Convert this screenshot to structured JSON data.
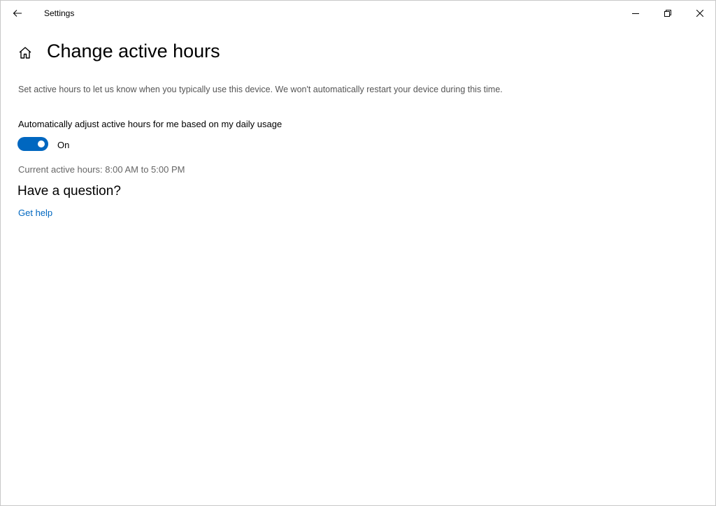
{
  "window": {
    "app_title": "Settings"
  },
  "page": {
    "title": "Change active hours",
    "description": "Set active hours to let us know when you typically use this device. We won't automatically restart your device during this time.",
    "auto_adjust_label": "Automatically adjust active hours for me based on my daily usage",
    "toggle_state": "On",
    "toggle_on": true,
    "current_hours": "Current active hours:  8:00 AM to  5:00 PM"
  },
  "help": {
    "heading": "Have a question?",
    "link": "Get help"
  },
  "colors": {
    "accent": "#0067c0",
    "secondary_text": "#555555",
    "background": "#ffffff"
  },
  "icons": {
    "back": "back-arrow-icon",
    "minimize": "minimize-icon",
    "restore": "restore-icon",
    "close": "close-icon",
    "home": "home-icon"
  }
}
